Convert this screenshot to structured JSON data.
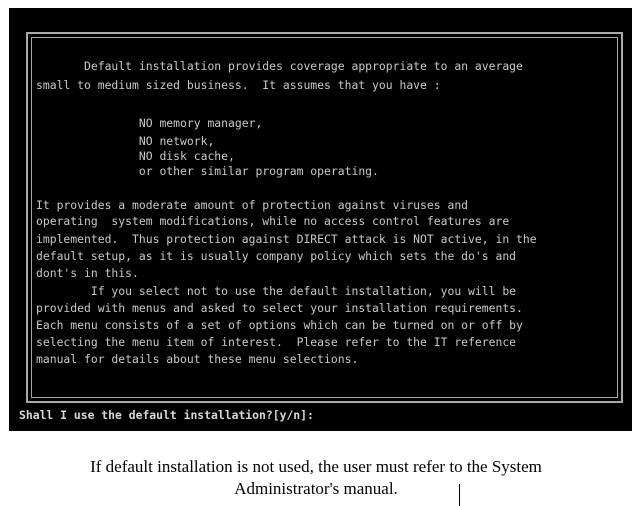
{
  "dialog": {
    "lines": [
      "       Default installation provides coverage appropriate to an average",
      "small to medium sized business.  It assumes that you have :",
      "",
      "               NO memory manager,",
      "               NO network,",
      "               NO disk cache,",
      "               or other similar program operating.",
      "",
      "It provides a moderate amount of protection against viruses and",
      "operating  system modifications, while no access control features are",
      "implemented.  Thus protection against DIRECT attack is NOT active, in the",
      "default setup, as it is usually company policy which sets the do's and",
      "dont's in this.",
      "        If you select not to use the default installation, you will be",
      "provided with menus and asked to select your installation requirements.",
      "Each menu consists of a set of options which can be turned on or off by",
      "selecting the menu item of interest.  Please refer to the IT reference",
      "manual for details about these menu selections."
    ]
  },
  "prompt": {
    "text": "Shall I use the default installation?[y/n]:"
  },
  "caption": {
    "line1": "If default installation is not used, the user must refer to the System",
    "line2": "Administrator's manual."
  }
}
